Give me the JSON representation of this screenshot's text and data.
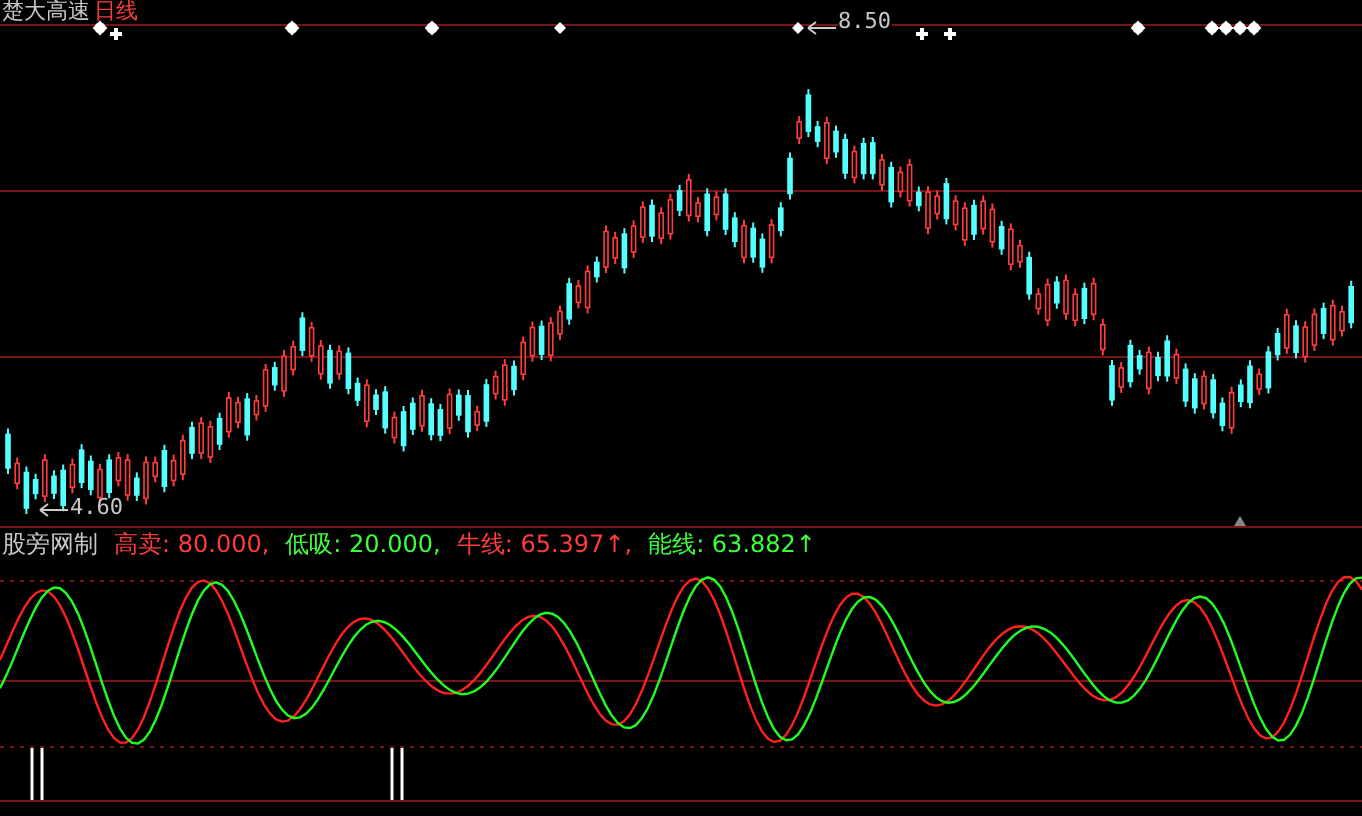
{
  "chart_header": {
    "name": "楚大高速",
    "period": "日线"
  },
  "price_labels": {
    "high": "8.50",
    "low": "4.60"
  },
  "indicator": {
    "name": "股旁网制",
    "items": [
      {
        "text": "高卖: 80.000,",
        "color": "#ff3c3c"
      },
      {
        "text": "低吸: 20.000,",
        "color": "#3cff3c"
      },
      {
        "text": "牛线: 65.397↑,",
        "color": "#ff3c3c"
      },
      {
        "text": "能线: 63.882↑",
        "color": "#3cff3c"
      }
    ]
  }
}
